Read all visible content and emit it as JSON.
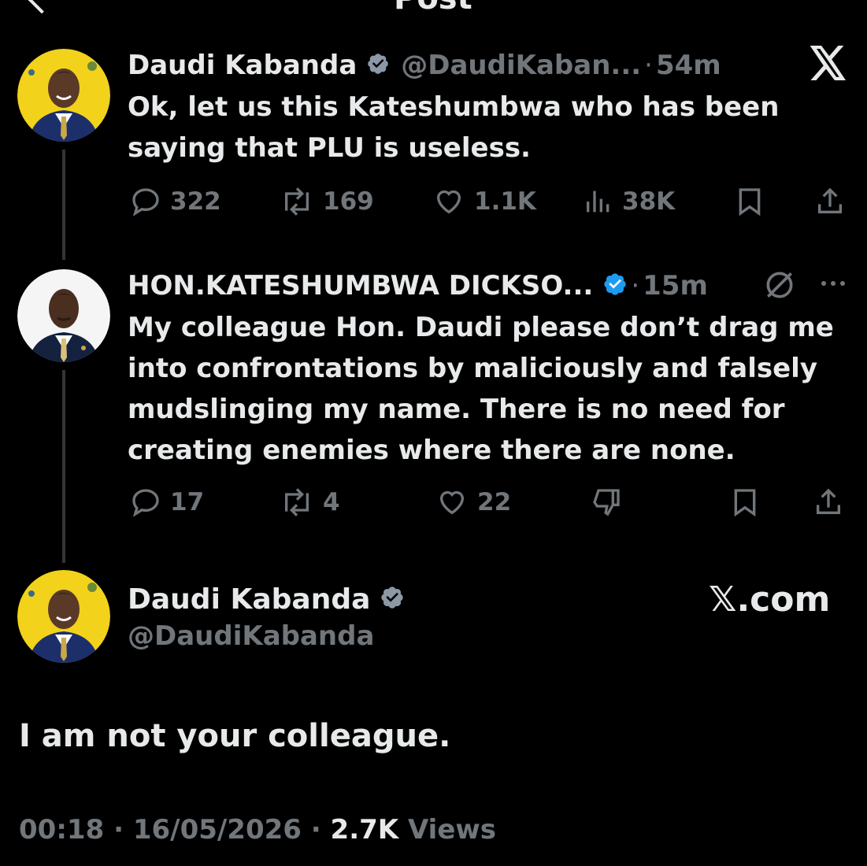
{
  "header": {
    "title": "Post"
  },
  "thread": [
    {
      "name": "Daudi Kabanda",
      "handle": "@DaudiKaban...",
      "separator": "·",
      "time": "54m",
      "text_lines": [
        "Ok, let us this Kateshumbwa who has been",
        "saying that PLU is useless."
      ],
      "replies": "322",
      "reposts": "169",
      "likes": "1.1K",
      "views": "38K"
    },
    {
      "name": "HON.KATESHUMBWA DICKSO...",
      "separator": "·",
      "time": "15m",
      "text_lines": [
        "My colleague Hon. Daudi please don’t drag me",
        "into confrontations  by maliciously and falsely",
        "mudslinging my name.  There is no need for",
        "creating enemies where there are none."
      ],
      "replies": "17",
      "reposts": "4",
      "likes": "22"
    }
  ],
  "main_post": {
    "name": "Daudi Kabanda",
    "handle": "@DaudiKabanda",
    "brand": "𝕏.com",
    "text": "I am not your colleague.",
    "time": "00:18",
    "separator": "·",
    "date": "16/05/2026",
    "separator2": "·",
    "views_count": "2.7K",
    "views_label": "Views"
  },
  "colors": {
    "background": "#000000",
    "text": "#e7e9ea",
    "muted": "#71767b",
    "verified": "#1d9bf0",
    "avatar_yellow": "#f2d21a"
  },
  "icons": [
    "back-icon",
    "verified-badge-icon",
    "x-logo-icon",
    "reply-icon",
    "repost-icon",
    "like-icon",
    "views-icon",
    "bookmark-icon",
    "share-icon",
    "mute-icon",
    "more-icon",
    "dislike-icon"
  ]
}
